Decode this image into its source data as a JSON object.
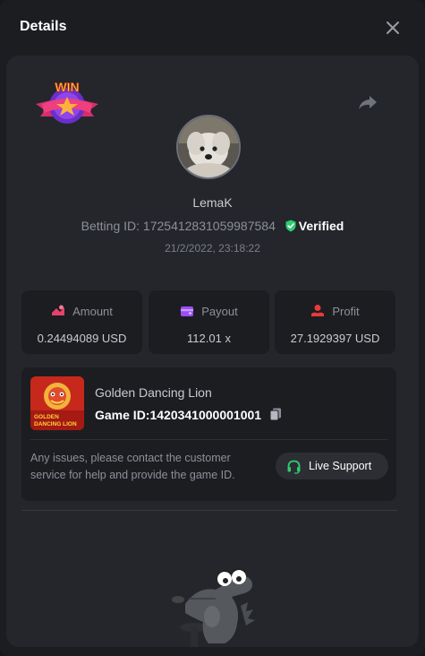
{
  "header": {
    "title": "Details",
    "close_icon": "close-icon"
  },
  "user": {
    "username": "LemaK",
    "betting_label": "Betting ID:",
    "betting_id": "1725412831059987584",
    "verified_label": "Verified",
    "timestamp": "21/2/2022, 23:18:22"
  },
  "badge": {
    "text": "WIN",
    "icon": "win-badge-icon"
  },
  "stats": [
    {
      "label": "Amount",
      "value": "0.24494089 USD",
      "icon": "amount-icon",
      "color": "#e8416b"
    },
    {
      "label": "Payout",
      "value": "112.01 x",
      "icon": "wallet-icon",
      "color": "#9b4dff"
    },
    {
      "label": "Profit",
      "value": "27.1929397 USD",
      "icon": "profit-icon",
      "color": "#e83b3b"
    }
  ],
  "game": {
    "name": "Golden Dancing Lion",
    "id_label": "Game ID:",
    "id_value": "1420341000001001",
    "thumb_text_line1": "GOLDEN",
    "thumb_text_line2": "DANCING LION",
    "support_text": "Any issues, please contact the customer service for help and provide the game ID.",
    "live_support_label": "Live Support"
  },
  "colors": {
    "verified": "#2ecc71",
    "support_icon": "#2ecc71"
  }
}
